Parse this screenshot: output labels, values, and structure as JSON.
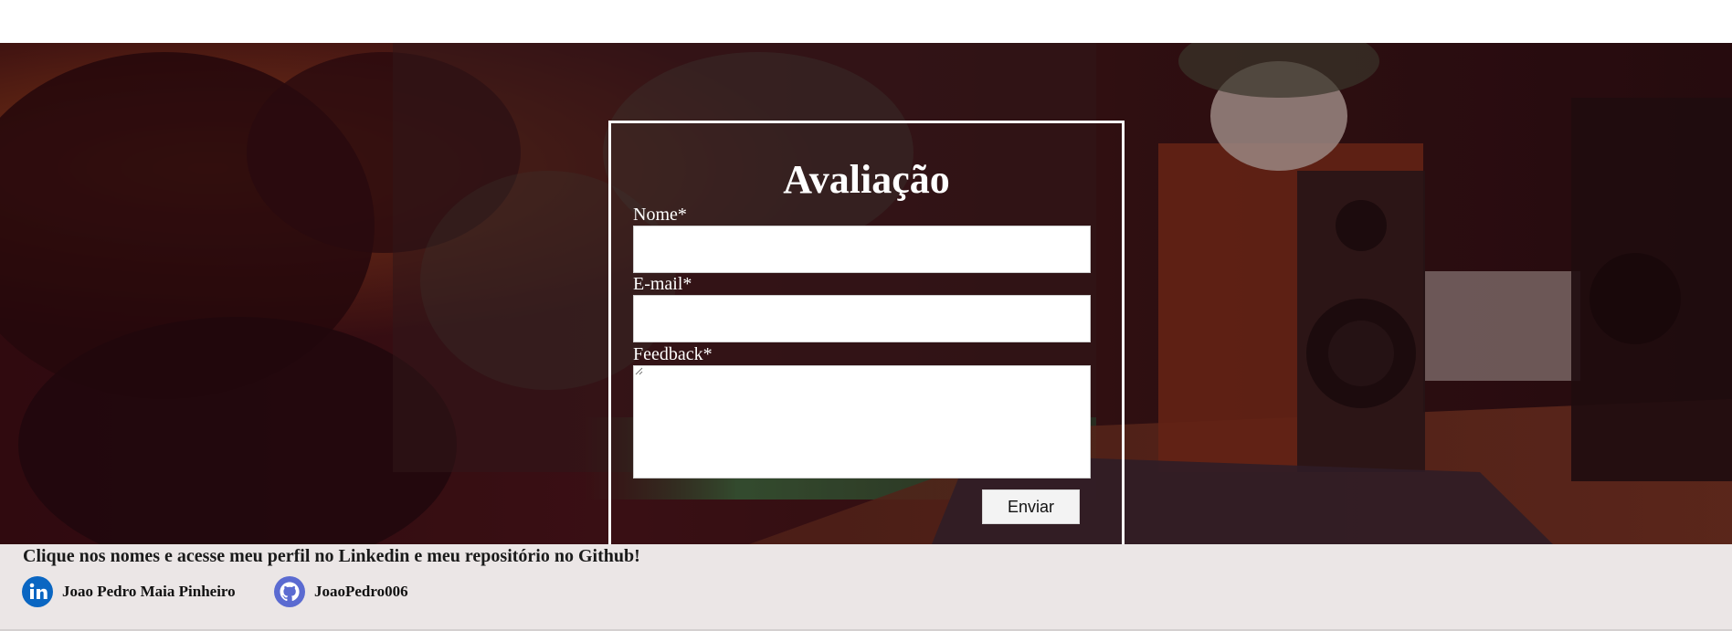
{
  "form": {
    "title": "Avaliação",
    "fields": [
      {
        "label": "Nome*",
        "value": ""
      },
      {
        "label": "E-mail*",
        "value": ""
      },
      {
        "label": "Feedback*",
        "value": ""
      }
    ],
    "submit_label": "Enviar"
  },
  "footer": {
    "intro": "Clique nos nomes e acesse meu perfil no Linkedin e meu repositório no Github!",
    "links": [
      {
        "icon": "linkedin-icon",
        "label": "Joao Pedro Maia Pinheiro",
        "color": "#0a66c2"
      },
      {
        "icon": "github-icon",
        "label": "JoaoPedro006",
        "color": "#5b6bd1"
      }
    ]
  },
  "colors": {
    "hero_tint": "#3a0d14",
    "footer_bg": "#ebe6e6",
    "form_border": "#ffffff"
  }
}
